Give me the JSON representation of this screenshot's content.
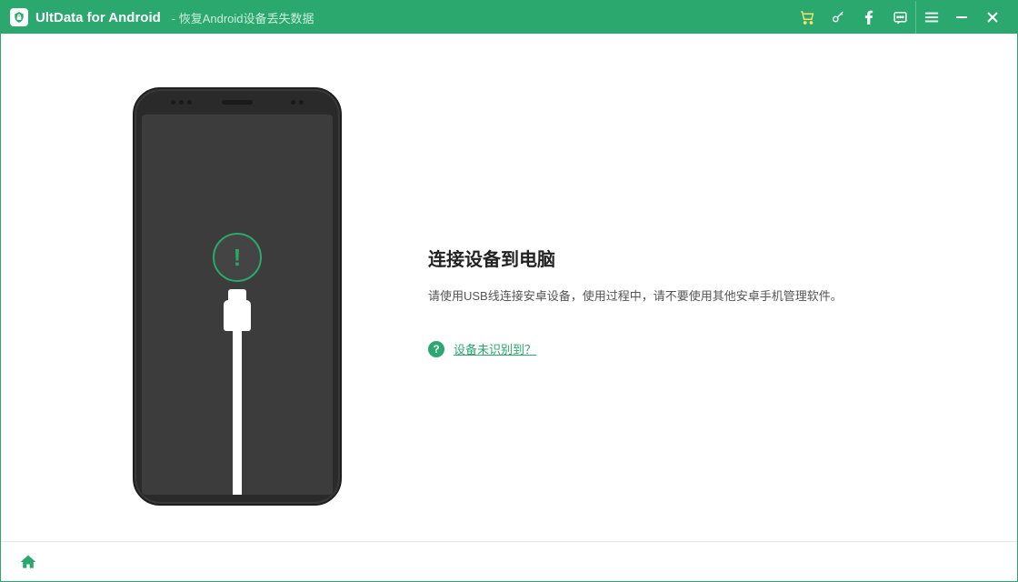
{
  "titlebar": {
    "app_name": "UltData for Android",
    "subtitle": " - 恢复Android设备丢失数据"
  },
  "content": {
    "heading": "连接设备到电脑",
    "description": "请使用USB线连接安卓设备，使用过程中，请不要使用其他安卓手机管理软件。",
    "help_link": "设备未识别到？",
    "alert_symbol": "!"
  },
  "icons": {
    "cart": "cart-icon",
    "key": "key-icon",
    "facebook": "facebook-icon",
    "feedback": "feedback-icon",
    "menu": "menu-icon",
    "minimize": "minimize-icon",
    "close": "close-icon",
    "home": "home-icon",
    "help": "?"
  }
}
